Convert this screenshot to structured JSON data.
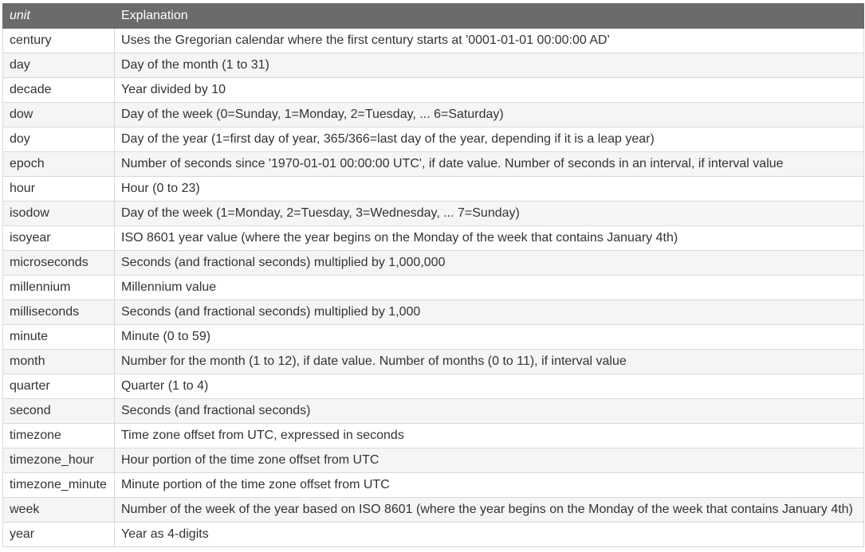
{
  "table": {
    "headers": [
      "unit",
      "Explanation"
    ],
    "rows": [
      [
        "century",
        "Uses the Gregorian calendar where the first century starts at '0001-01-01 00:00:00 AD'"
      ],
      [
        "day",
        "Day of the month (1 to 31)"
      ],
      [
        "decade",
        "Year divided by 10"
      ],
      [
        "dow",
        "Day of the week (0=Sunday, 1=Monday, 2=Tuesday, ... 6=Saturday)"
      ],
      [
        "doy",
        "Day of the year (1=first day of year, 365/366=last day of the year, depending if it is a leap year)"
      ],
      [
        "epoch",
        "Number of seconds since '1970-01-01 00:00:00 UTC', if date value. Number of seconds in an interval, if interval value"
      ],
      [
        "hour",
        "Hour (0 to 23)"
      ],
      [
        "isodow",
        "Day of the week (1=Monday, 2=Tuesday, 3=Wednesday, ... 7=Sunday)"
      ],
      [
        "isoyear",
        "ISO 8601 year value (where the year begins on the Monday of the week that contains January 4th)"
      ],
      [
        "microseconds",
        "Seconds (and fractional seconds) multiplied by 1,000,000"
      ],
      [
        "millennium",
        "Millennium value"
      ],
      [
        "milliseconds",
        "Seconds (and fractional seconds) multiplied by 1,000"
      ],
      [
        "minute",
        "Minute (0 to 59)"
      ],
      [
        "month",
        "Number for the month (1 to 12), if date value. Number of months (0 to 11), if interval value"
      ],
      [
        "quarter",
        "Quarter (1 to 4)"
      ],
      [
        "second",
        "Seconds (and fractional seconds)"
      ],
      [
        "timezone",
        "Time zone offset from UTC, expressed in seconds"
      ],
      [
        "timezone_hour",
        "Hour portion of the time zone offset from UTC"
      ],
      [
        "timezone_minute",
        "Minute portion of the time zone offset from UTC"
      ],
      [
        "week",
        "Number of the week of the year based on ISO 8601 (where the year begins on the Monday of the week that contains January 4th)"
      ],
      [
        "year",
        "Year as 4-digits"
      ]
    ]
  }
}
